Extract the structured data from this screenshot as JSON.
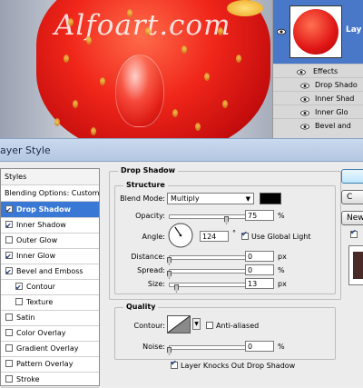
{
  "canvas": {
    "watermark": "Alfoart.com"
  },
  "layers_panel": {
    "layer_name": "Lay",
    "effects_label": "Effects",
    "effects": [
      "Drop Shado",
      "Inner Shad",
      "Inner Glo",
      "Bevel and"
    ]
  },
  "dialog": {
    "title": "ayer Style",
    "styles_list": {
      "header": "Styles",
      "blending": "Blending Options: Custom",
      "items": [
        {
          "label": "Drop Shadow",
          "checked": true,
          "selected": true
        },
        {
          "label": "Inner Shadow",
          "checked": true
        },
        {
          "label": "Outer Glow",
          "checked": false
        },
        {
          "label": "Inner Glow",
          "checked": true
        },
        {
          "label": "Bevel and Emboss",
          "checked": true
        },
        {
          "label": "Contour",
          "checked": true,
          "indent": true
        },
        {
          "label": "Texture",
          "checked": false,
          "indent": true
        },
        {
          "label": "Satin",
          "checked": false
        },
        {
          "label": "Color Overlay",
          "checked": false
        },
        {
          "label": "Gradient Overlay",
          "checked": false
        },
        {
          "label": "Pattern Overlay",
          "checked": false
        },
        {
          "label": "Stroke",
          "checked": false
        }
      ]
    },
    "drop_shadow": {
      "title": "Drop Shadow",
      "structure_title": "Structure",
      "blend_mode_label": "Blend Mode:",
      "blend_mode_value": "Multiply",
      "shadow_color": "#000000",
      "opacity_label": "Opacity:",
      "opacity_value": "75",
      "opacity_unit": "%",
      "opacity_level": 0.75,
      "angle_label": "Angle:",
      "angle_value": "124",
      "angle_unit": "°",
      "use_global_light_label": "Use Global Light",
      "use_global_light": true,
      "distance_label": "Distance:",
      "distance_value": "0",
      "distance_unit": "px",
      "spread_label": "Spread:",
      "spread_value": "0",
      "spread_unit": "%",
      "size_label": "Size:",
      "size_value": "13",
      "size_unit": "px",
      "quality_title": "Quality",
      "contour_label": "Contour:",
      "anti_aliased_label": "Anti-aliased",
      "noise_label": "Noise:",
      "noise_value": "0",
      "noise_unit": "%",
      "knockout_label": "Layer Knocks Out Drop Shadow",
      "knockout": true
    },
    "buttons": [
      "",
      "C",
      "New",
      ""
    ]
  },
  "colors": {
    "selection": "#3a78d6",
    "title_bar": "#c9d9ee"
  }
}
